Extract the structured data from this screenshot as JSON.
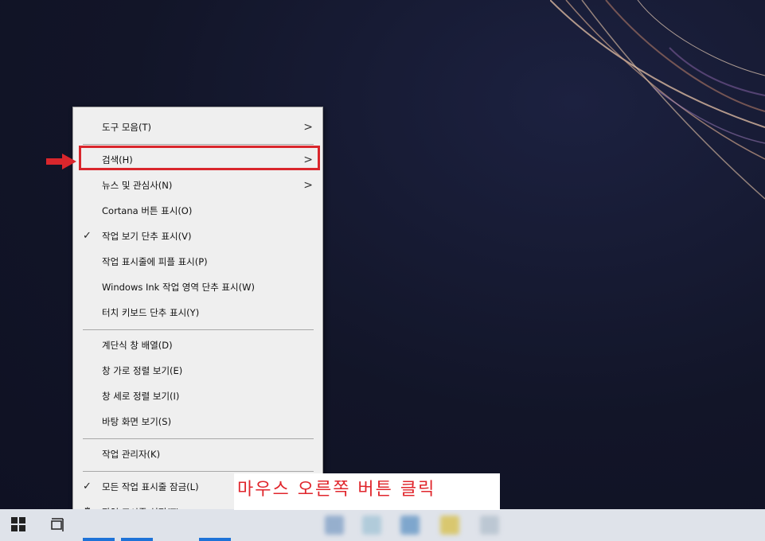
{
  "context_menu": {
    "items": [
      {
        "label": "도구 모음(T)"
      },
      {
        "label": "검색(H)"
      },
      {
        "label": "뉴스 및 관심사(N)"
      },
      {
        "label": "Cortana 버튼 표시(O)"
      },
      {
        "label": "작업 보기 단추 표시(V)"
      },
      {
        "label": "작업 표시줄에 피플 표시(P)"
      },
      {
        "label": "Windows Ink 작업 영역 단추 표시(W)"
      },
      {
        "label": "터치 키보드 단추 표시(Y)"
      },
      {
        "label": "계단식 창 배열(D)"
      },
      {
        "label": "창 가로 정렬 보기(E)"
      },
      {
        "label": "창 세로 정렬 보기(I)"
      },
      {
        "label": "바탕 화면 보기(S)"
      },
      {
        "label": "작업 관리자(K)"
      },
      {
        "label": "모든 작업 표시줄 잠금(L)"
      },
      {
        "label": "작업 표시줄 설정(T)"
      }
    ],
    "submenu_glyph": ">",
    "check_glyph": "✓",
    "gear_glyph": "⚙"
  },
  "annotation": {
    "callout_text": "마우스 오른쪽 버튼 클릭",
    "highlight_color": "#d9262c"
  },
  "icons": {
    "start": "windows-start-icon",
    "task_view": "task-view-icon"
  }
}
